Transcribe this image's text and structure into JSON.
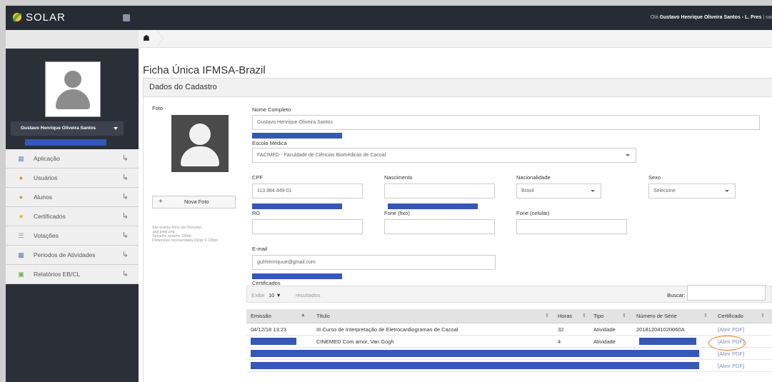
{
  "app": {
    "logo_text": "SOLAR",
    "greeting_prefix": "Olá ",
    "greeting_name": "Gustavo Henrique Oliveira Santos - L. Pres",
    "greeting_suffix": " | sai"
  },
  "sidebar": {
    "user_name": "Gustavo Henrique Oliveira Santos",
    "items": [
      {
        "label": "Aplicação",
        "icon": "app-icon"
      },
      {
        "label": "Usuários",
        "icon": "users-icon"
      },
      {
        "label": "Alunos",
        "icon": "students-icon"
      },
      {
        "label": "Certificados",
        "icon": "certificates-icon"
      },
      {
        "label": "Votações",
        "icon": "votes-icon"
      },
      {
        "label": "Periodos de Atividades",
        "icon": "calendar-icon"
      },
      {
        "label": "Relatórios EB/CL",
        "icon": "reports-icon"
      }
    ],
    "colors": {
      "accent": "#3457b8",
      "topbar": "#262b34",
      "sidebar": "#2b2f38"
    }
  },
  "page": {
    "title": "Ficha Única IFMSA-Brazil",
    "panel_title": "Dados do Cadastro"
  },
  "photo": {
    "label": "Foto",
    "new_photo_label": "Nova Foto",
    "help_lines": [
      "São aceitos fotos nos formatos:",
      ".jpg/.jpeg/.png.",
      "Tamanho máximo 100kb.",
      "Dimensões recomendada 100px X 100px"
    ]
  },
  "form": {
    "full_name_label": "Nome Completo",
    "full_name_value": "Gustavo Henrique Oliveira Santos",
    "school_label": "Escola Médica",
    "school_value": "FACIMED - Faculdade de Ciências Biomédicas de Cacoal",
    "cpf_label": "CPF",
    "cpf_value": "113.984.449-01",
    "birth_label": "Nascimento",
    "nationality_label": "Nacionalidade",
    "nationality_value": "Brasil",
    "sex_label": "Sexo",
    "sex_value": "Selecione",
    "rg_label": "RG",
    "phone_fixed_label": "Fone (fixo)",
    "phone_cell_label": "Fone (celular)",
    "email_label": "E-mail",
    "email_value": "guhhenriquue@gmail.com"
  },
  "certificates": {
    "label": "Certificados",
    "show_prefix": "Exibir",
    "show_value": "10",
    "show_suffix": "resultados",
    "search_label": "Buscar:",
    "columns": [
      "Emissão",
      "Título",
      "Horas",
      "Tipo",
      "Número de Série",
      "Certificado"
    ],
    "rows": [
      {
        "date": "04/12/18 13:23",
        "title": "III Curso de Interpretação de Eletrocardiogramas de Cacoal",
        "hours": "32",
        "type": "Atividade",
        "serial": "201812041020060A",
        "link": "[Abrir PDF]"
      },
      {
        "date": "",
        "title": "CINEMED Com amor, Van Gogh",
        "hours": "4",
        "type": "Atividade",
        "serial": "",
        "link": "[Abrir PDF]"
      },
      {
        "date": "",
        "title": "",
        "hours": "",
        "type": "",
        "serial": "",
        "link": "[Abrir PDF]"
      },
      {
        "date": "",
        "title": "",
        "hours": "",
        "type": "",
        "serial": "",
        "link": "[Abrir PDF]"
      }
    ]
  }
}
